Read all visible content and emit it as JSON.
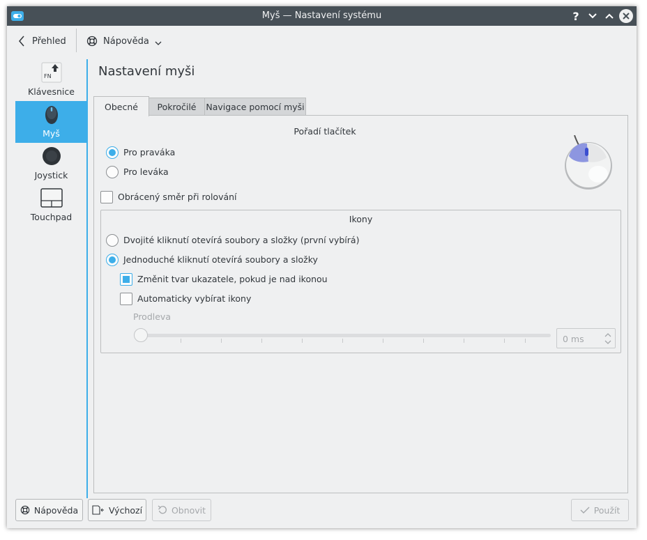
{
  "window": {
    "title": "Myš  — Nastavení systému",
    "help_button": "?",
    "app_icon": "system-settings-icon",
    "close_icon": "close-icon",
    "minimize_icon": "chevron-down-icon",
    "maximize_icon": "chevron-up-icon"
  },
  "toolbar": {
    "back_label": "Přehled",
    "help_label": "Nápověda"
  },
  "sidebar": {
    "items": [
      {
        "label": "Klávesnice",
        "icon": "keyboard-fn-icon",
        "selected": false
      },
      {
        "label": "Myš",
        "icon": "mouse-icon",
        "selected": true
      },
      {
        "label": "Joystick",
        "icon": "joystick-icon",
        "selected": false
      },
      {
        "label": "Touchpad",
        "icon": "touchpad-icon",
        "selected": false
      }
    ]
  },
  "page": {
    "title": "Nastavení myši"
  },
  "tabs": [
    {
      "label": "Obecné",
      "active": true
    },
    {
      "label": "Pokročilé",
      "active": false
    },
    {
      "label": "Navigace pomocí myši",
      "active": false
    }
  ],
  "general": {
    "button_order_title": "Pořadí tlačítek",
    "right_handed": "Pro praváka",
    "left_handed": "Pro leváka",
    "reverse_scroll": "Obrácený směr při rolování",
    "icons_title": "Ikony",
    "double_click": "Dvojité kliknutí otevírá soubory a složky (první vybírá)",
    "single_click": "Jednoduché kliknutí otevírá soubory a složky",
    "change_pointer": "Změnit tvar ukazatele, pokud je nad ikonou",
    "auto_select": "Automaticky vybírat ikony",
    "delay_label": "Prodleva",
    "delay_value": "0 ms",
    "delay_fraction": 0
  },
  "buttons": {
    "help": "Nápověda",
    "defaults": "Výchozí",
    "reset": "Obnovit",
    "apply": "Použít"
  },
  "colors": {
    "accent": "#3daee9",
    "titlebar": "#475057",
    "window_bg": "#eff0f1",
    "text": "#31363b"
  }
}
